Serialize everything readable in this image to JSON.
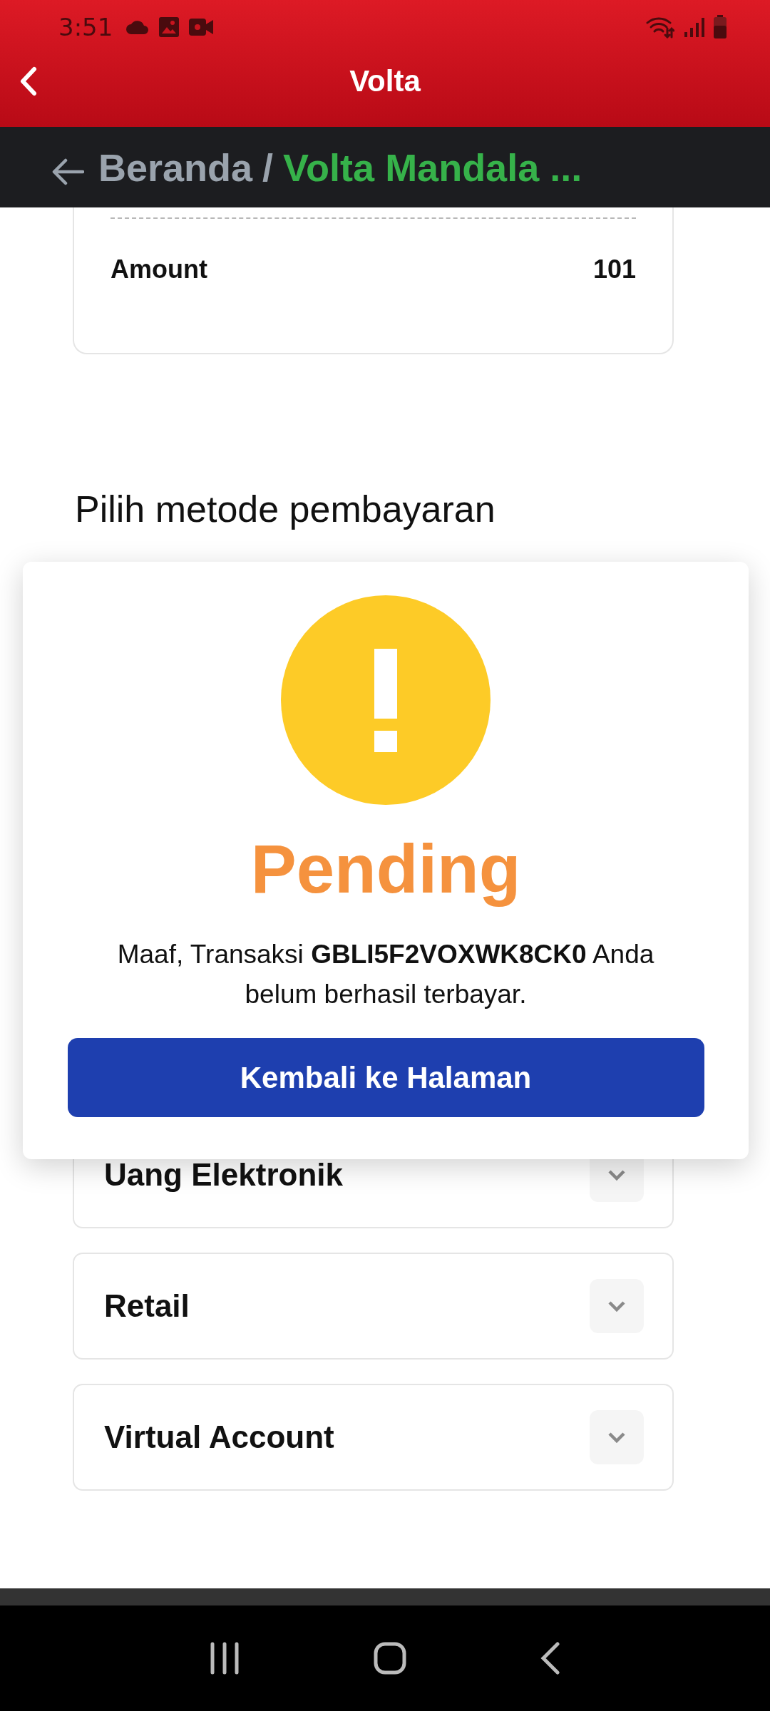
{
  "status_bar": {
    "time": "3:51"
  },
  "app_bar": {
    "title": "Volta"
  },
  "breadcrumb": {
    "home": "Beranda",
    "separator": "/",
    "current": "Volta Mandala ..."
  },
  "summary": {
    "rows": [
      {
        "label": "Amount",
        "value": "101"
      }
    ]
  },
  "payment": {
    "heading": "Pilih metode pembayaran",
    "methods": [
      {
        "name": "Uang Elektronik",
        "expanded": false
      },
      {
        "name": "Retail",
        "expanded": false
      },
      {
        "name": "Virtual Account",
        "expanded": false
      }
    ]
  },
  "dialog": {
    "kind": "pending",
    "status": "Pending",
    "message": "Maaf, Transaksi **GBLI5F2VOXWK8CK0** Anda belum berhasil terbayar.",
    "button": "Kembali ke Halaman"
  }
}
